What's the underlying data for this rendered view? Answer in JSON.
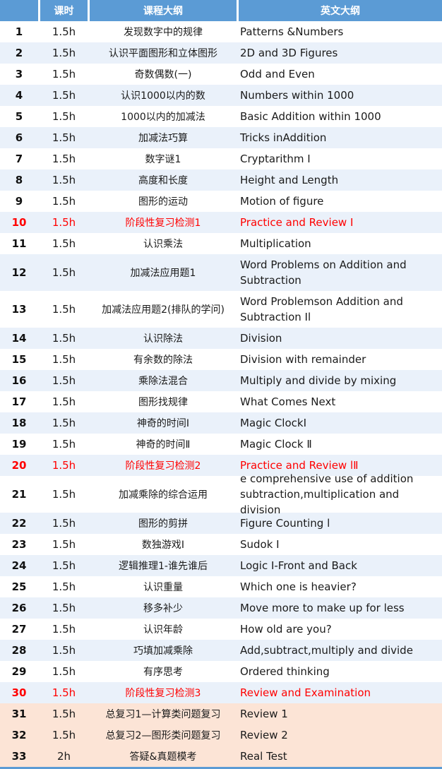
{
  "colors": {
    "header_bg": "#5B9BD5",
    "alt_row_bg": "#EAF1FA",
    "review_row_bg": "#FCE4D6",
    "highlight_text": "#FF0000"
  },
  "header": {
    "col1": "",
    "col2": "课时",
    "col3": "课程大纲",
    "col4": "英文大纲"
  },
  "rows": [
    {
      "num": "1",
      "hours": "1.5h",
      "cn": "发现数字中的规律",
      "en": "Patterns &Numbers"
    },
    {
      "num": "2",
      "hours": "1.5h",
      "cn": "认识平面图形和立体图形",
      "en": "2D and 3D Figures"
    },
    {
      "num": "3",
      "hours": "1.5h",
      "cn": "奇数偶数(一)",
      "en": "Odd and Even"
    },
    {
      "num": "4",
      "hours": "1.5h",
      "cn": "认识1000以内的数",
      "en": "Numbers within 1000"
    },
    {
      "num": "5",
      "hours": "1.5h",
      "cn": "1000以内的加减法",
      "en": "Basic Addition within 1000"
    },
    {
      "num": "6",
      "hours": "1.5h",
      "cn": "加减法巧算",
      "en": "Tricks inAddition"
    },
    {
      "num": "7",
      "hours": "1.5h",
      "cn": "数字谜1",
      "en": "Cryptarithm I"
    },
    {
      "num": "8",
      "hours": "1.5h",
      "cn": "高度和长度",
      "en": "Height and Length"
    },
    {
      "num": "9",
      "hours": "1.5h",
      "cn": "图形的运动",
      "en": "Motion of figure"
    },
    {
      "num": "10",
      "hours": "1.5h",
      "cn": "阶段性复习检测1",
      "en": "Practice and Review I"
    },
    {
      "num": "11",
      "hours": "1.5h",
      "cn": "认识乘法",
      "en": "Multiplication"
    },
    {
      "num": "12",
      "hours": "1.5h",
      "cn": "加减法应用题1",
      "en": "Word Problems on Addition and Subtraction"
    },
    {
      "num": "13",
      "hours": "1.5h",
      "cn": "加减法应用题2(排队的学问)",
      "en": "Word Problemson Addition and Subtraction Il"
    },
    {
      "num": "14",
      "hours": "1.5h",
      "cn": "认识除法",
      "en": "Division"
    },
    {
      "num": "15",
      "hours": "1.5h",
      "cn": "有余数的除法",
      "en": "Division with remainder"
    },
    {
      "num": "16",
      "hours": "1.5h",
      "cn": "乘除法混合",
      "en": "Multiply and divide by mixing"
    },
    {
      "num": "17",
      "hours": "1.5h",
      "cn": "图形找规律",
      "en": "What Comes Next"
    },
    {
      "num": "18",
      "hours": "1.5h",
      "cn": "神奇的时间I",
      "en": "Magic ClockI"
    },
    {
      "num": "19",
      "hours": "1.5h",
      "cn": "神奇的时间Ⅱ",
      "en": "Magic Clock Ⅱ"
    },
    {
      "num": "20",
      "hours": "1.5h",
      "cn": "阶段性复习检测2",
      "en": "Practice and Review lⅡ"
    },
    {
      "num": "21",
      "hours": "1.5h",
      "cn": "加减乘除的综合运用",
      "en": "e comprehensive use of addition subtraction,multiplication and division"
    },
    {
      "num": "22",
      "hours": "1.5h",
      "cn": "图形的剪拼",
      "en": "Figure Counting l"
    },
    {
      "num": "23",
      "hours": "1.5h",
      "cn": "数独游戏I",
      "en": "Sudok I"
    },
    {
      "num": "24",
      "hours": "1.5h",
      "cn": "逻辑推理1-谁先谁后",
      "en": "Logic I-Front and Back"
    },
    {
      "num": "25",
      "hours": "1.5h",
      "cn": "认识重量",
      "en": "Which one is heavier?"
    },
    {
      "num": "26",
      "hours": "1.5h",
      "cn": "移多补少",
      "en": "Move more to make up for less"
    },
    {
      "num": "27",
      "hours": "1.5h",
      "cn": "认识年龄",
      "en": "How old are you?"
    },
    {
      "num": "28",
      "hours": "1.5h",
      "cn": "巧填加减乘除",
      "en": "Add,subtract,multiply and divide"
    },
    {
      "num": "29",
      "hours": "1.5h",
      "cn": "有序思考",
      "en": "Ordered thinking"
    },
    {
      "num": "30",
      "hours": "1.5h",
      "cn": "阶段性复习检测3",
      "en": "Review and Examination"
    },
    {
      "num": "31",
      "hours": "1.5h",
      "cn": "总复习1—计算类问题复习",
      "en": "Review 1"
    },
    {
      "num": "32",
      "hours": "1.5h",
      "cn": "总复习2—图形类问题复习",
      "en": "Review 2"
    },
    {
      "num": "33",
      "hours": "2h",
      "cn": "答疑&真题模考",
      "en": "Real Test"
    }
  ]
}
